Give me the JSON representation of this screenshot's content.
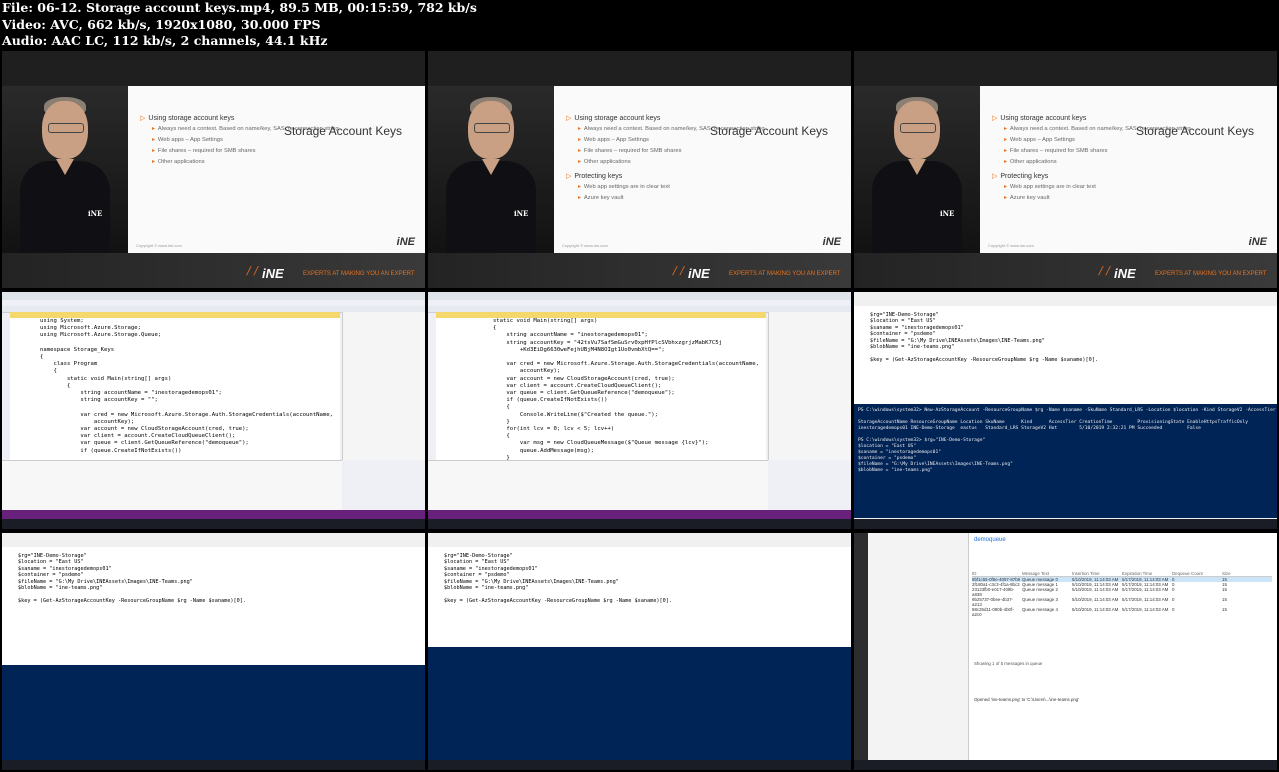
{
  "header": {
    "line1": "File: 06-12. Storage account keys.mp4, 89.5 MB, 00:15:59, 782 kb/s",
    "line2": "Video: AVC, 662 kb/s, 1920x1080, 30.000 FPS",
    "line3": "Audio: AAC LC, 112 kb/s, 2 channels, 44.1 kHz"
  },
  "slide": {
    "title": "Storage Account Keys",
    "bullet1": "Using storage account keys",
    "sub1": "Always need a context. Based on name/key, SAS, or connection string",
    "sub2": "Web apps – App Settings",
    "sub3": "File shares – required for SMB shares",
    "sub4": "Other applications",
    "bullet2": "Protecting keys",
    "sub5": "Web app settings are in clear text",
    "sub6": "Azure key vault",
    "copyright": "Copyright © www.ine.com",
    "footer_tag": "EXPERTS AT MAKING YOU AN EXPERT",
    "logo": "iNE"
  },
  "vs1": {
    "lines": [
      "using System;",
      "using Microsoft.Azure.Storage;",
      "using Microsoft.Azure.Storage.Queue;",
      "",
      "namespace Storage_Keys",
      "{",
      "    class Program",
      "    {",
      "        static void Main(string[] args)",
      "        {",
      "            string accountName = \"inestoragedemops01\";",
      "            string accountKey = \"\";",
      "",
      "            var cred = new Microsoft.Azure.Storage.Auth.StorageCredentials(accountName,",
      "                accountKey);",
      "            var account = new CloudStorageAccount(cred, true);",
      "            var client = account.CreateCloudQueueClient();",
      "            var queue = client.GetQueueReference(\"demoqueue\");",
      "            if (queue.CreateIfNotExists())"
    ]
  },
  "vs2": {
    "lines": [
      "        static void Main(string[] args)",
      "        {",
      "            string accountName = \"inestoragedemops01\";",
      "            string accountKey = \"42tsVu7SafSmGuSrv0xpHfPlcSVbhxzgrjzMabK7C5j",
      "                +Kd3EiDg6630weFejhUBjM4N8OIgt1Uo0vmbXtQ==\";",
      "",
      "            var cred = new Microsoft.Azure.Storage.Auth.StorageCredentials(accountName,",
      "                accountKey);",
      "            var account = new CloudStorageAccount(cred, true);",
      "            var client = account.CreateCloudQueueClient();",
      "            var queue = client.GetQueueReference(\"demoqueue\");",
      "            if (queue.CreateIfNotExists())",
      "            {",
      "                Console.WriteLine($\"Created the queue.\");",
      "            }",
      "            for(int lcv = 0; lcv < 5; lcv++)",
      "            {",
      "                var msg = new CloudQueueMessage($\"Queue message {lcv}\");",
      "                queue.AddMessage(msg);",
      "            }"
    ]
  },
  "ps1": {
    "script": [
      "$rg=\"INE-Demo-Storage\"",
      "$location = \"East US\"",
      "$saname = \"inestoragedemops01\"",
      "$container = \"psdemo\"",
      "$fileName = \"G:\\My Drive\\INEAssets\\Images\\INE-Teams.png\"",
      "$blobName = \"ine-teams.png\"",
      "",
      "$key = (Get-AzStorageAccountKey -ResourceGroupName $rg -Name $saname)[0]."
    ],
    "console": [
      "PS C:\\windows\\system32> New-AzStorageAccount -ResourceGroupName $rg -Name $saname -SkuName Standard_LRS -Location $location -Kind StorageV2 -AccessTier Hot",
      "",
      "StorageAccountName ResourceGroupName Location SkuName      Kind      AccessTier CreationTime         ProvisioningState EnableHttpsTrafficOnly",
      "inestoragedemops01 INE-Demo-Storage  eastus   Standard_LRS StorageV2 Hot        5/10/2019 2:32:21 PM Succeeded         False",
      "",
      "PS C:\\windows\\system32> $rg=\"INE-Demo-Storage\"",
      "$location = \"East US\"",
      "$saname = \"inestoragedemops01\"",
      "$container = \"psdemo\"",
      "$fileName = \"G:\\My Drive\\INEAssets\\Images\\INE-Teams.png\"",
      "$blobName = \"ine-teams.png\""
    ]
  },
  "explorer": {
    "title": "demoqueue",
    "columns": [
      "ID",
      "Message Text",
      "Insertion Time",
      "Expiration Time",
      "Dequeue Count",
      "Size"
    ],
    "rows": [
      [
        "8bf1c55-0f6e-4097-87b9",
        "Queue message 0",
        "5/10/2019, 11:14:03 AM",
        "5/17/2019, 11:14:03 AM",
        "0",
        "15"
      ],
      [
        "3f180a1-c3c3-4f1a-8bc3",
        "Queue message 1",
        "5/10/2019, 11:14:03 AM",
        "5/17/2019, 11:14:03 AM",
        "0",
        "15"
      ],
      [
        "23123fb0-e017-409b-a838",
        "Queue message 2",
        "5/10/2019, 11:14:03 AM",
        "5/17/2019, 11:14:03 AM",
        "0",
        "15"
      ],
      [
        "9b25737-0bee-4b37-a213",
        "Queue message 3",
        "5/10/2019, 11:14:03 AM",
        "5/17/2019, 11:14:03 AM",
        "0",
        "15"
      ],
      [
        "88c25d11-080b-4b0f-a2c0",
        "Queue message 4",
        "5/10/2019, 11:14:03 AM",
        "5/17/2019, 11:14:03 AM",
        "0",
        "15"
      ]
    ],
    "status": "Showing 1 of 5 messages in queue",
    "activity": "Opened 'ine-teams.png' to 'C:\\Users\\...\\ine-teams.png'"
  },
  "colors": {
    "accent": "#e8731e",
    "ps_bg": "#012456",
    "vs_purple": "#68217a"
  }
}
